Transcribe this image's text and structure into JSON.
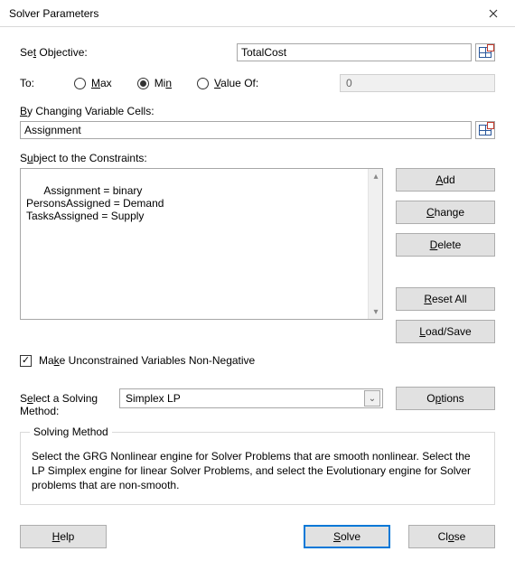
{
  "window": {
    "title": "Solver Parameters"
  },
  "objective": {
    "label_pre": "Se",
    "label_u": "t",
    "label_post": " Objective:",
    "value": "TotalCost"
  },
  "to": {
    "label": "To:",
    "max_u": "M",
    "max_rest": "ax",
    "min_label": "Mi",
    "min_u": "n",
    "value_u": "V",
    "value_rest": "alue Of:",
    "value_of": "0",
    "selected": "min"
  },
  "changing": {
    "label_u": "B",
    "label_rest": "y Changing Variable Cells:",
    "value": "Assignment"
  },
  "constraints": {
    "label_pre": "S",
    "label_u": "u",
    "label_post": "bject to the Constraints:",
    "lines": "Assignment = binary\nPersonsAssigned = Demand\nTasksAssigned = Supply"
  },
  "sidebtn": {
    "add_u": "A",
    "add_rest": "dd",
    "change_u": "C",
    "change_rest": "hange",
    "delete_u": "D",
    "delete_rest": "elete",
    "reset_u": "R",
    "reset_rest": "eset All",
    "load_u": "L",
    "load_rest": "oad/Save",
    "options_pre": "O",
    "options_u": "p",
    "options_post": "tions"
  },
  "checkbox": {
    "checked": true,
    "label_pre": "Ma",
    "label_u": "k",
    "label_post": "e Unconstrained Variables Non-Negative"
  },
  "method": {
    "label_pre": "S",
    "label_u": "e",
    "label_post": "lect a Solving\nMethod:",
    "value": "Simplex LP"
  },
  "groupbox": {
    "title": "Solving Method",
    "text": "Select the GRG Nonlinear engine for Solver Problems that are smooth nonlinear. Select the LP Simplex engine for linear Solver Problems, and select the Evolutionary engine for Solver problems that are non-smooth."
  },
  "footer": {
    "help_u": "H",
    "help_rest": "elp",
    "solve_u": "S",
    "solve_rest": "olve",
    "close_pre": "Cl",
    "close_u": "o",
    "close_post": "se"
  }
}
